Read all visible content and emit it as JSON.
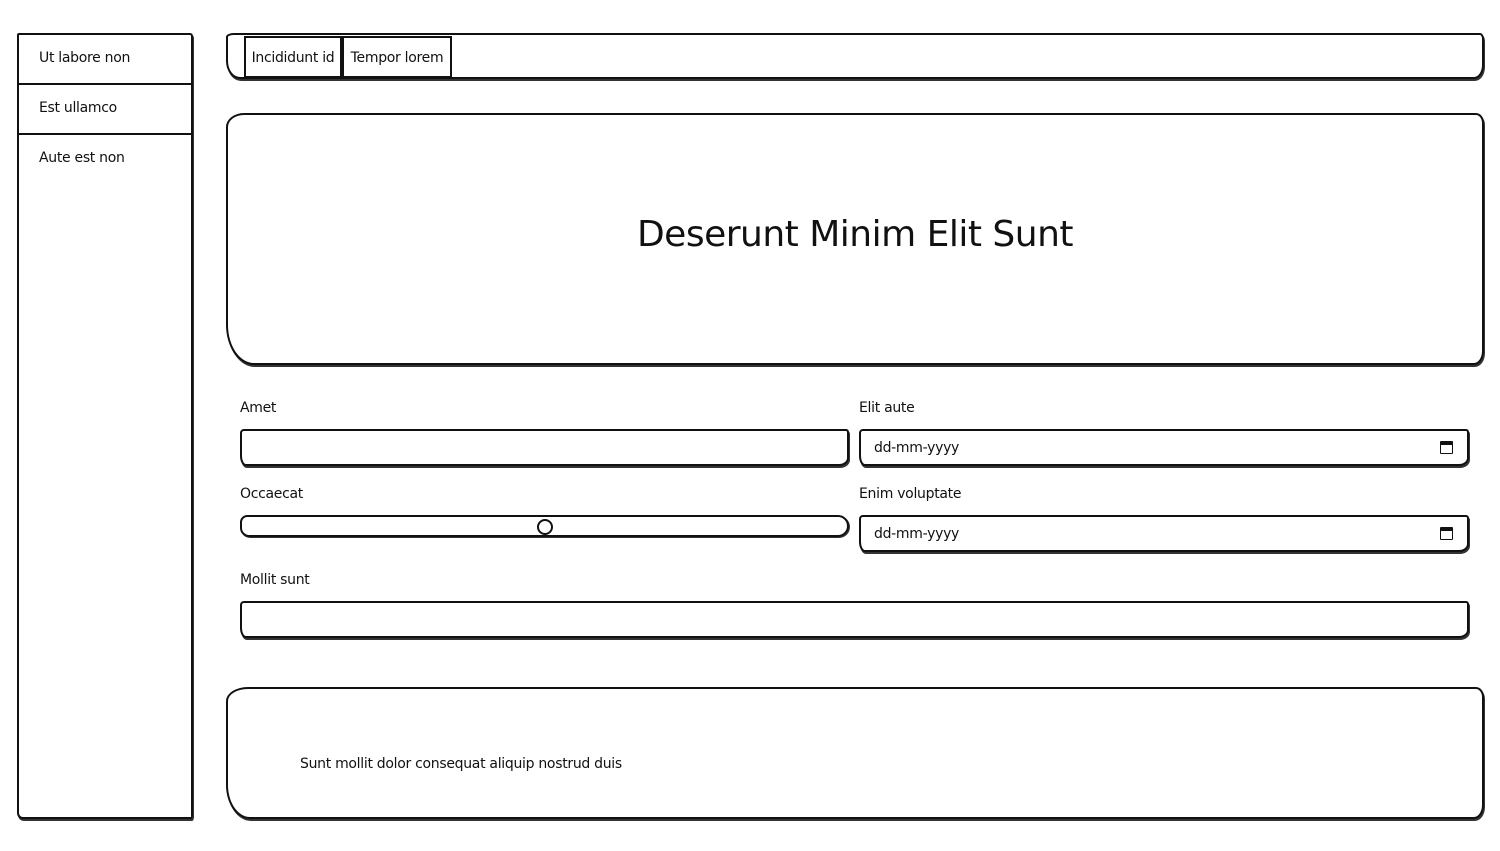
{
  "sidebar": {
    "items": [
      {
        "label": "Ut labore non"
      },
      {
        "label": "Est ullamco"
      },
      {
        "label": "Aute est non"
      }
    ]
  },
  "tabs": [
    {
      "label": "Incididunt id"
    },
    {
      "label": "Tempor lorem"
    }
  ],
  "hero": {
    "title": "Deserunt Minim Elit Sunt"
  },
  "form": {
    "amet": {
      "label": "Amet",
      "value": ""
    },
    "elit_aute": {
      "label": "Elit aute",
      "placeholder": "dd-mm-yyyy"
    },
    "occaecat": {
      "label": "Occaecat",
      "value_fraction": 0.5
    },
    "enim_voluptate": {
      "label": "Enim voluptate",
      "placeholder": "dd-mm-yyyy"
    },
    "mollit_sunt": {
      "label": "Mollit sunt",
      "value": ""
    }
  },
  "footer": {
    "text": "Sunt mollit dolor consequat aliquip nostrud duis"
  }
}
